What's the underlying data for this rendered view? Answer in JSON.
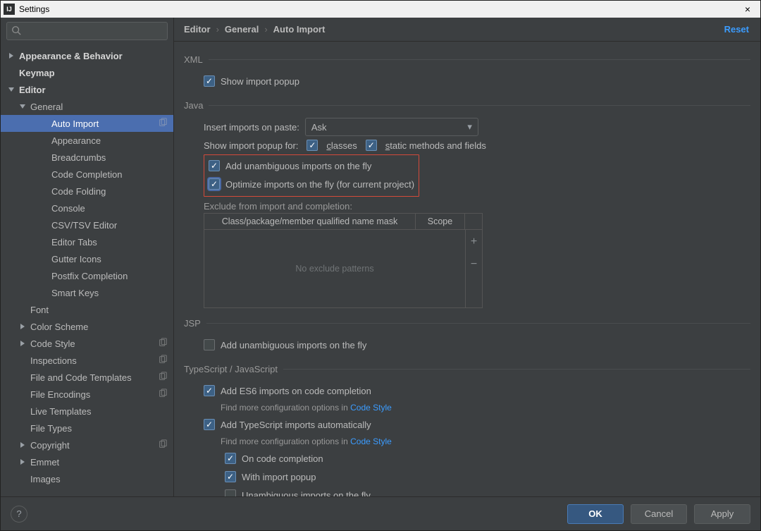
{
  "window": {
    "title": "Settings",
    "close": "×"
  },
  "search": {
    "placeholder": ""
  },
  "sidebar": {
    "items": [
      {
        "label": "Appearance & Behavior",
        "level": 0,
        "arrow": "right"
      },
      {
        "label": "Keymap",
        "level": 0,
        "arrow": "none"
      },
      {
        "label": "Editor",
        "level": 0,
        "arrow": "down"
      },
      {
        "label": "General",
        "level": 1,
        "arrow": "down"
      },
      {
        "label": "Auto Import",
        "level": 2,
        "copy": true,
        "selected": true
      },
      {
        "label": "Appearance",
        "level": 2
      },
      {
        "label": "Breadcrumbs",
        "level": 2
      },
      {
        "label": "Code Completion",
        "level": 2
      },
      {
        "label": "Code Folding",
        "level": 2
      },
      {
        "label": "Console",
        "level": 2
      },
      {
        "label": "CSV/TSV Editor",
        "level": 2
      },
      {
        "label": "Editor Tabs",
        "level": 2
      },
      {
        "label": "Gutter Icons",
        "level": 2
      },
      {
        "label": "Postfix Completion",
        "level": 2
      },
      {
        "label": "Smart Keys",
        "level": 2
      },
      {
        "label": "Font",
        "level": 1
      },
      {
        "label": "Color Scheme",
        "level": 1,
        "arrow": "right"
      },
      {
        "label": "Code Style",
        "level": 1,
        "arrow": "right",
        "copy": true
      },
      {
        "label": "Inspections",
        "level": 1,
        "copy": true
      },
      {
        "label": "File and Code Templates",
        "level": 1,
        "copy": true
      },
      {
        "label": "File Encodings",
        "level": 1,
        "copy": true
      },
      {
        "label": "Live Templates",
        "level": 1
      },
      {
        "label": "File Types",
        "level": 1
      },
      {
        "label": "Copyright",
        "level": 1,
        "arrow": "right",
        "copy": true
      },
      {
        "label": "Emmet",
        "level": 1,
        "arrow": "right"
      },
      {
        "label": "Images",
        "level": 1
      }
    ]
  },
  "breadcrumb": {
    "a": "Editor",
    "b": "General",
    "c": "Auto Import"
  },
  "reset": "Reset",
  "xml": {
    "legend": "XML",
    "show_popup": "Show import popup"
  },
  "java": {
    "legend": "Java",
    "insert_label": "Insert imports on paste:",
    "insert_value": "Ask",
    "show_for_label": "Show import popup for:",
    "classes_pre": "c",
    "classes_rest": "lasses",
    "static_pre": "s",
    "static_rest": "tatic methods and fields",
    "add_unamb": "Add unambiguous imports on the fly",
    "optimize": "Optimize imports on the fly (for current project)",
    "exclude_label": "Exclude from import and completion:",
    "col_mask": "Class/package/member qualified name mask",
    "col_scope": "Scope",
    "empty": "No exclude patterns"
  },
  "jsp": {
    "legend": "JSP",
    "add_unamb": "Add unambiguous imports on the fly"
  },
  "ts": {
    "legend": "TypeScript / JavaScript",
    "add_es6": "Add ES6 imports on code completion",
    "find_more": "Find more configuration options in ",
    "code_style": "Code Style",
    "add_ts": "Add TypeScript imports automatically",
    "on_cc": "On code completion",
    "with_popup": "With import popup",
    "unamb": "Unambiguous imports on the fly"
  },
  "buttons": {
    "ok": "OK",
    "cancel": "Cancel",
    "apply": "Apply"
  }
}
